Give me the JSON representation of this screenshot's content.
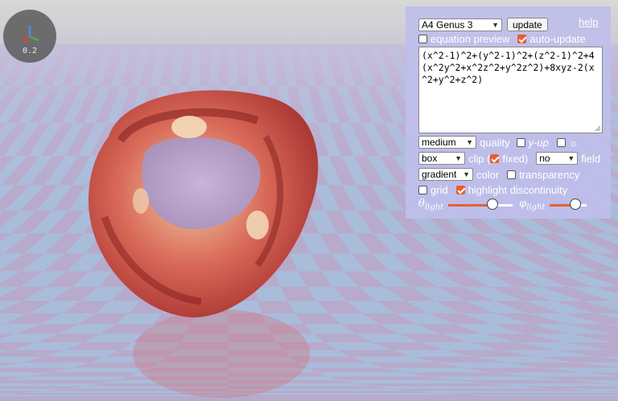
{
  "gizmo": {
    "value": "0.2"
  },
  "panel": {
    "surface_select": "A4 Genus 3",
    "update_label": "update",
    "help_label": "help",
    "equation_preview": {
      "label": "equation preview",
      "checked": false
    },
    "auto_update": {
      "label": "auto-update",
      "checked": true
    },
    "equation": "(x^2-1)^2+(y^2-1)^2+(z^2-1)^2+4(x^2y^2+x^2z^2+y^2z^2)+8xyz-2(x^2+y^2+z^2)",
    "quality_select": "medium",
    "quality_label": "quality",
    "y_up": {
      "label": "y-up",
      "checked": false
    },
    "sun": {
      "label": "☼",
      "checked": false
    },
    "clip_select": "box",
    "clip_label": "clip (",
    "fixed": {
      "label": "fixed)",
      "checked": true
    },
    "field_select": "no",
    "field_label": "field",
    "color_select": "gradient",
    "color_label": "color",
    "transparency": {
      "label": "transparency",
      "checked": false
    },
    "grid": {
      "label": "grid",
      "checked": false
    },
    "highlight": {
      "label": "highlight discontinuity",
      "checked": true
    },
    "theta_label": "θ",
    "theta_sub": "light",
    "phi_label": "φ",
    "phi_sub": "light",
    "theta_value": 0.72,
    "phi_value": 0.78
  },
  "colors": {
    "accent": "#e8602c",
    "panel": "#bebeeb"
  }
}
